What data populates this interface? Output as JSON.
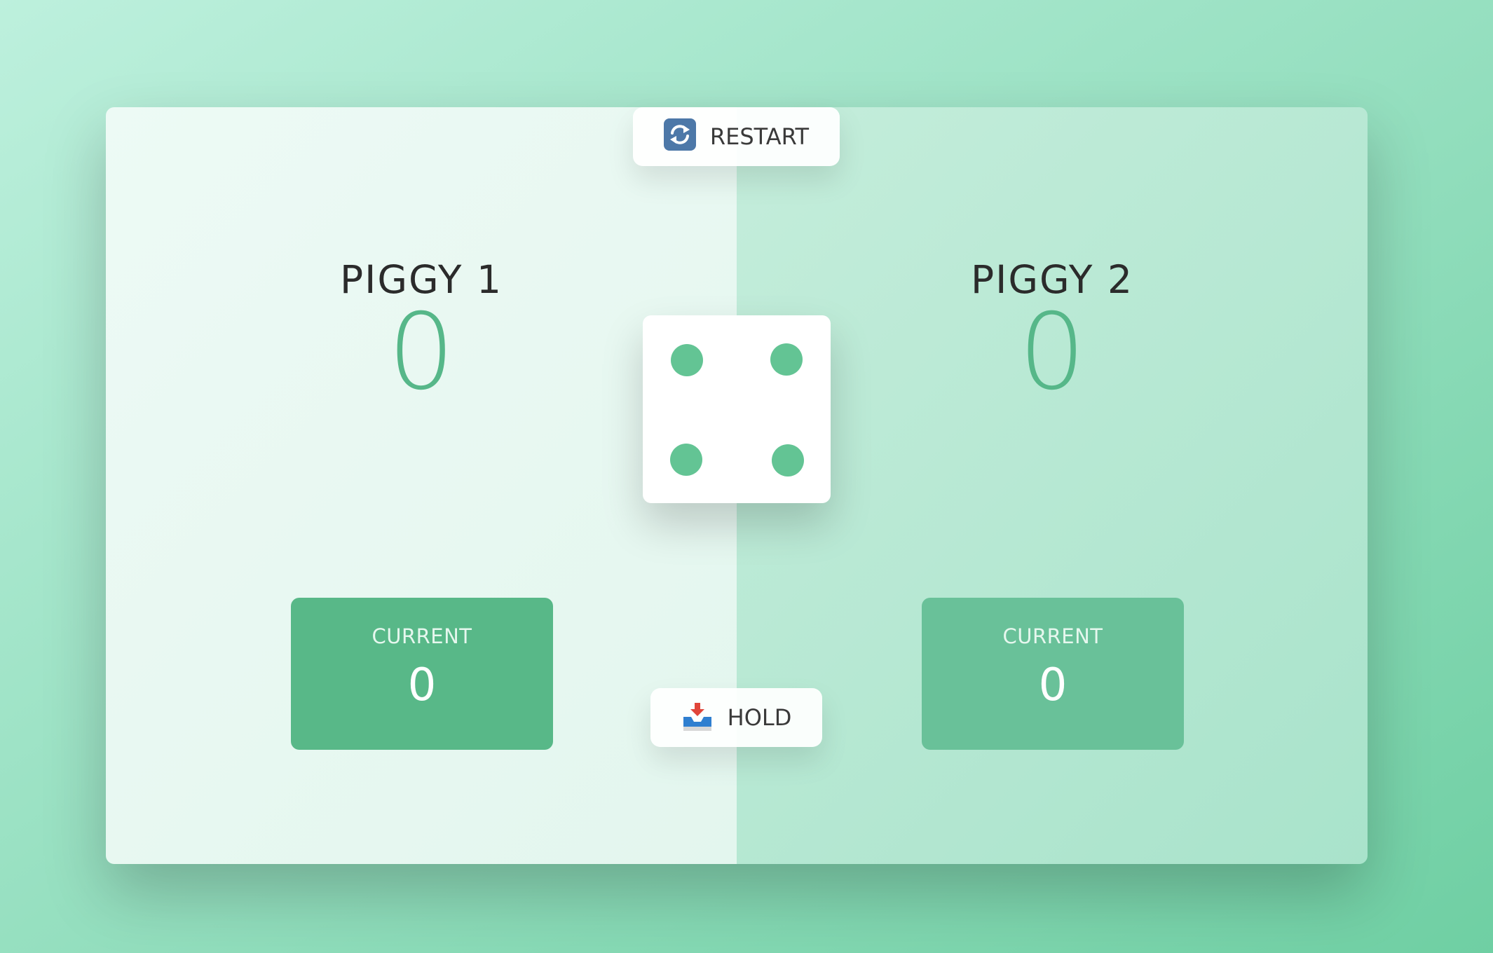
{
  "buttons": {
    "restart_label": "RESTART",
    "restart_icon": "restart-arrows-icon",
    "hold_label": "HOLD",
    "hold_icon": "inbox-tray-icon"
  },
  "players": [
    {
      "name": "PIGGY 1",
      "score": "0",
      "current_label": "CURRENT",
      "current_score": "0"
    },
    {
      "name": "PIGGY 2",
      "score": "0",
      "current_label": "CURRENT",
      "current_score": "0"
    }
  ],
  "dice": {
    "value": 4
  },
  "colors": {
    "accent": "#56b789",
    "pip": "#63c494",
    "current_box_1": "#58b888",
    "current_box_2": "#69c199"
  }
}
